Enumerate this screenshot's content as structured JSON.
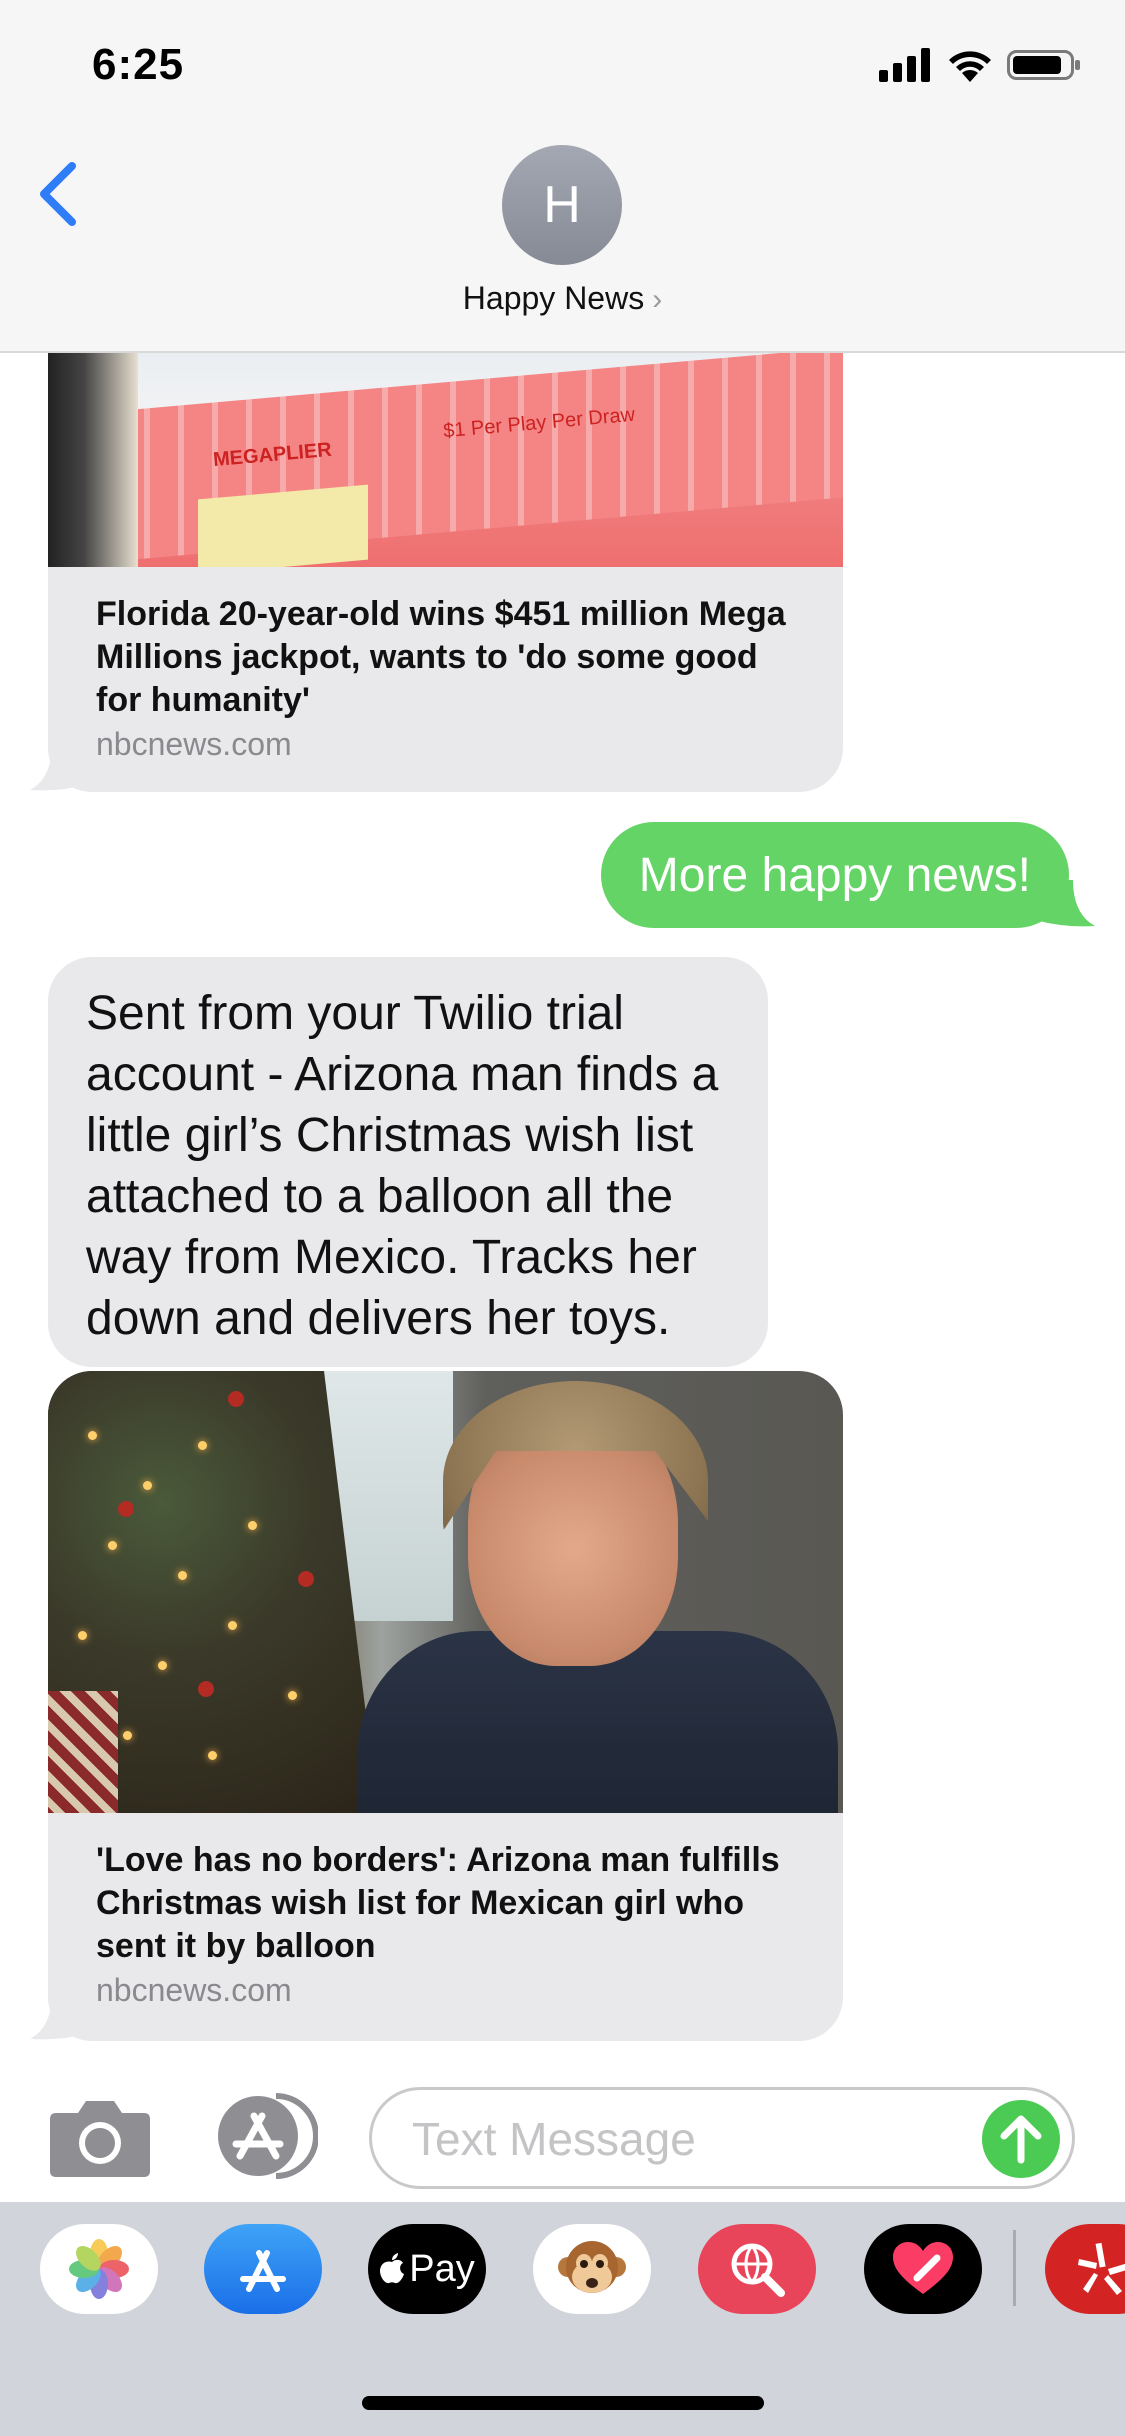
{
  "status_bar": {
    "time": "6:25"
  },
  "header": {
    "avatar_initial": "H",
    "contact_name": "Happy News"
  },
  "messages": {
    "card1": {
      "image_text_1": "MEGAPLIER",
      "image_text_2": "$1 Per Play Per Draw",
      "title": "Florida 20-year-old wins $451 million Mega Millions jackpot, wants to 'do some good for humanity'",
      "source": "nbcnews.com"
    },
    "outgoing": {
      "text": "More happy news!"
    },
    "incoming": {
      "text": "Sent from your Twilio trial account - Arizona man finds a little girl’s Christmas wish list attached to a balloon all the way from Mexico. Tracks her down and delivers her toys."
    },
    "card2": {
      "title": "'Love has no borders': Arizona man fulfills Christmas wish list for Mexican girl who sent it by balloon",
      "source": "nbcnews.com"
    }
  },
  "composer": {
    "placeholder": "Text Message"
  },
  "app_drawer": {
    "apps": [
      {
        "name": "Photos",
        "icon": "photos-icon"
      },
      {
        "name": "App Store",
        "icon": "app-store-icon"
      },
      {
        "name": "Apple Pay",
        "icon": "apple-pay-icon",
        "label": "Pay"
      },
      {
        "name": "Animoji",
        "icon": "monkey-icon"
      },
      {
        "name": "Images search",
        "icon": "globe-search-icon"
      },
      {
        "name": "Digital Touch",
        "icon": "heart-icon"
      },
      {
        "name": "Yelp",
        "icon": "yelp-icon"
      }
    ]
  },
  "colors": {
    "accent_blue": "#2f7df6",
    "outgoing_bubble": "#65d466",
    "incoming_bubble": "#e9e9eb",
    "send_button": "#4ccb54",
    "drawer_bg": "#d2d4db"
  }
}
